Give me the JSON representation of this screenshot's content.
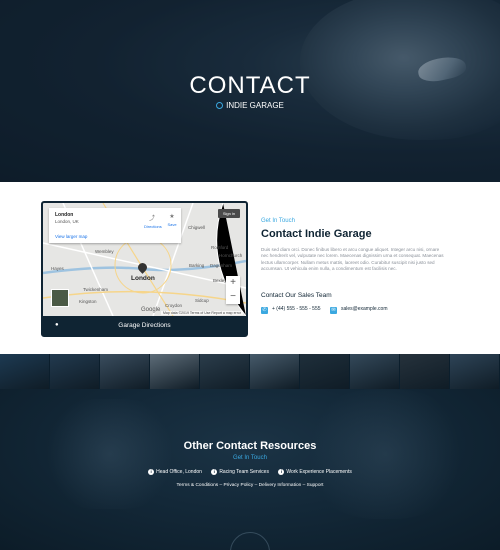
{
  "hero": {
    "title": "CONTACT",
    "breadcrumb": "INDIE GARAGE"
  },
  "map": {
    "popup_title": "London",
    "popup_subtitle": "London, UK",
    "popup_link": "View larger map",
    "directions_label": "Directions",
    "save_label": "Save",
    "signin_label": "Sign in",
    "center_label": "London",
    "places": [
      "Wembley",
      "Twickenham",
      "Hayes",
      "Romford",
      "Barking",
      "Dagenham",
      "Bexley",
      "Sidcup",
      "Croydon",
      "Chigwell",
      "Hornchurch",
      "Kingston"
    ],
    "zoom_in": "+",
    "zoom_out": "−",
    "google_label": "Google",
    "attribution": "Map data ©2019   Terms of Use   Report a map error",
    "directions_bar": "Garage Directions"
  },
  "contact": {
    "eyebrow": "Get In Touch",
    "title": "Contact Indie Garage",
    "body": "Duis sed diam orci. Donec finibus libero et arcu congue aliquet. Integer arcu nisi, ornare nec hendrerit vel, vulputate nec lorem. Maecenas dignissim urna et consequat. Maecenas lectus ullamcorper. Nullam metus mattis, laoreet odio. Curabitur suscipit nisi justo sed accumsan. Ut vehicula enim nulla, a condimentum est facilisis nec.",
    "sales_heading": "Contact Our Sales Team",
    "phone": "+ (44) 555 - 555 - 555",
    "email": "sales@example.com"
  },
  "gallery": {
    "tiles": [
      "#1d3a52",
      "#223a4f",
      "#3a4d5e",
      "#5d6c78",
      "#2b3d4b",
      "#465a6a",
      "#1f2f3b",
      "#34495a",
      "#26323c",
      "#2e4457"
    ]
  },
  "footer": {
    "title": "Other Contact Resources",
    "subtitle": "Get In Touch",
    "links": [
      "Head Office, London",
      "Racing Team Services",
      "Work Experience Placements"
    ],
    "legal": "Terms & Conditions – Privacy Policy – Delivery Information – Support"
  },
  "colors": {
    "accent": "#3aa8e0",
    "navy": "#0f2433"
  }
}
